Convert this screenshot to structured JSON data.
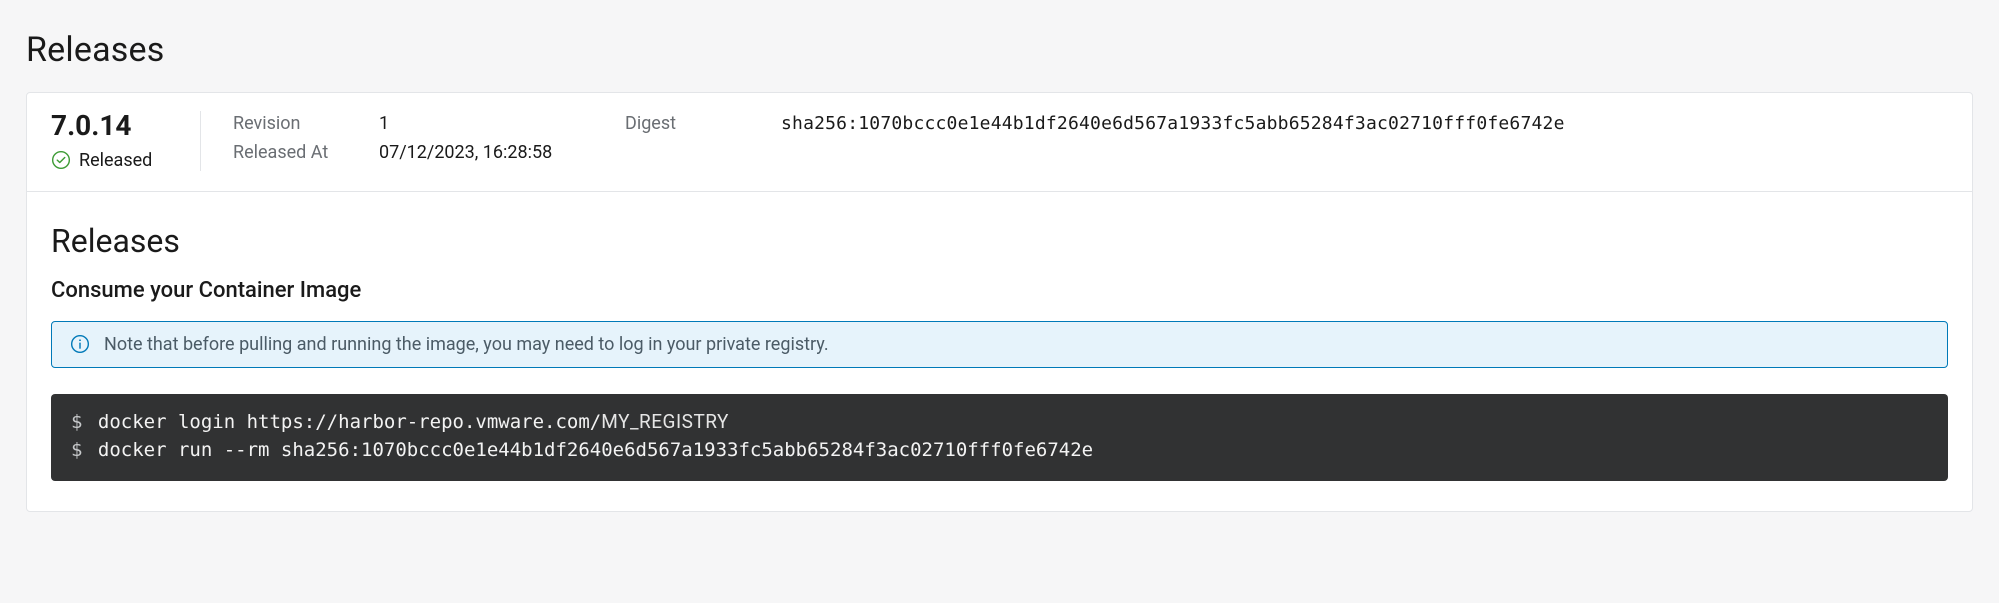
{
  "page": {
    "title": "Releases"
  },
  "release": {
    "version": "7.0.14",
    "status_label": "Released",
    "meta": {
      "revision_label": "Revision",
      "revision_value": "1",
      "released_at_label": "Released At",
      "released_at_value": "07/12/2023, 16:28:58",
      "digest_label": "Digest",
      "digest_value": "sha256:1070bccc0e1e44b1df2640e6d567a1933fc5abb65284f3ac02710fff0fe6742e"
    }
  },
  "section": {
    "title": "Releases",
    "subtitle": "Consume your Container Image",
    "alert": "Note that before pulling and running the image, you may need to log in your private registry.",
    "code": {
      "line1_cmd": "docker login https://harbor-repo.vmware.com/",
      "line1_placeholder": "MY_REGISTRY",
      "line2_cmd": "docker run --rm sha256:1070bccc0e1e44b1df2640e6d567a1933fc5abb65284f3ac02710fff0fe6742e"
    }
  }
}
